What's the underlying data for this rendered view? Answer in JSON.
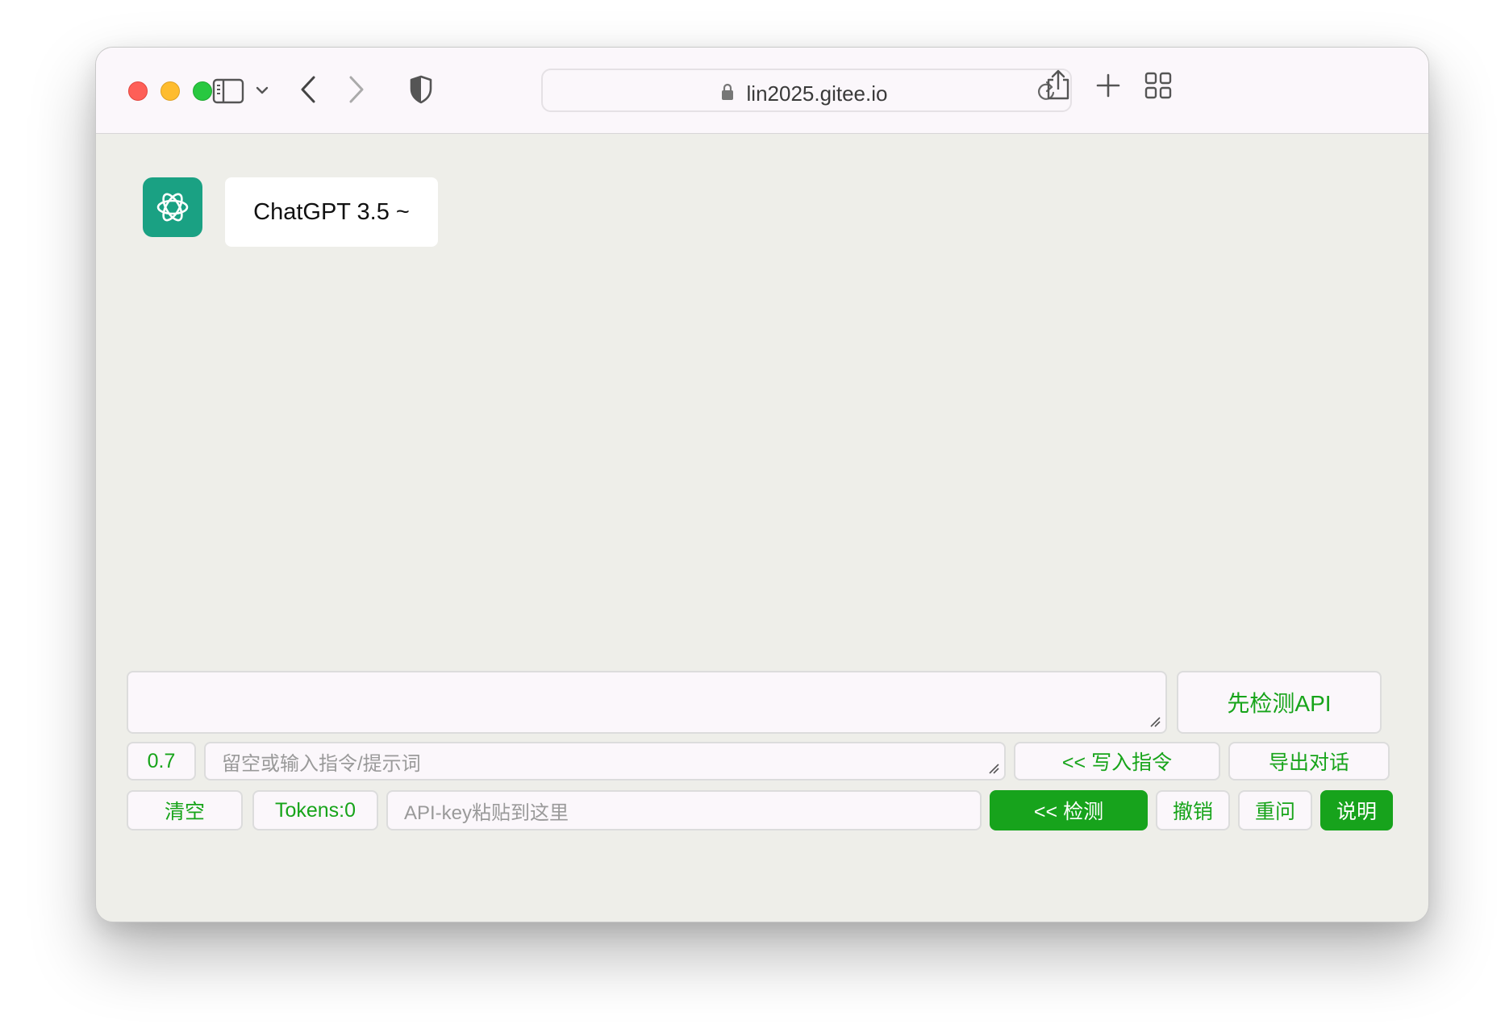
{
  "browser": {
    "url": "lin2025.gitee.io"
  },
  "chat": {
    "bot_name": "ChatGPT 3.5 ~"
  },
  "controls": {
    "message_value": "",
    "check_api_label": "先检测API",
    "temperature": "0.7",
    "prompt_placeholder": "留空或输入指令/提示词",
    "write_prompt_label": "<< 写入指令",
    "export_label": "导出对话",
    "clear_label": "清空",
    "tokens_label": "Tokens:0",
    "apikey_placeholder": "API-key粘贴到这里",
    "detect_label": "<< 检测",
    "undo_label": "撤销",
    "reask_label": "重问",
    "help_label": "说明"
  },
  "colors": {
    "accent_green": "#17a31c",
    "avatar_teal": "#1aa183"
  }
}
